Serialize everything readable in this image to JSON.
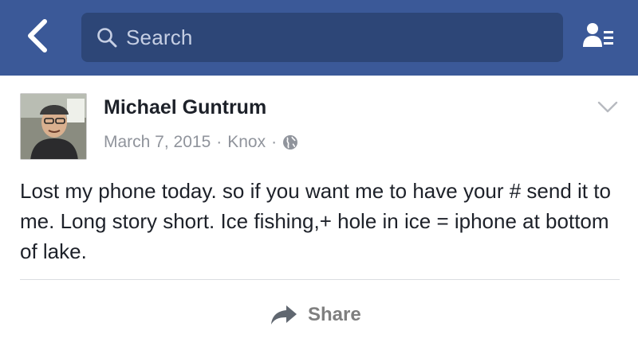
{
  "colors": {
    "top_bar": "#3b5998",
    "search_field": "#2d4677",
    "secondary_text": "#90949c",
    "share_text": "#7f7f7f"
  },
  "top_bar": {
    "back_icon": "chevron-left-icon",
    "search": {
      "icon": "search-icon",
      "placeholder": "Search"
    },
    "friends_icon": "friend-requests-icon"
  },
  "post": {
    "avatar_icon": "profile-photo",
    "author": "Michael Guntrum",
    "date": "March 7, 2015",
    "separator": "·",
    "location": "Knox",
    "privacy_icon": "globe-icon",
    "menu_icon": "chevron-down-icon",
    "text": "Lost my phone today. so if you want me to have your # send it to me. Long story short. Ice fishing,+ hole in ice = iphone at bottom of lake.",
    "actions": {
      "share_icon": "share-arrow-icon",
      "share_label": "Share"
    }
  }
}
